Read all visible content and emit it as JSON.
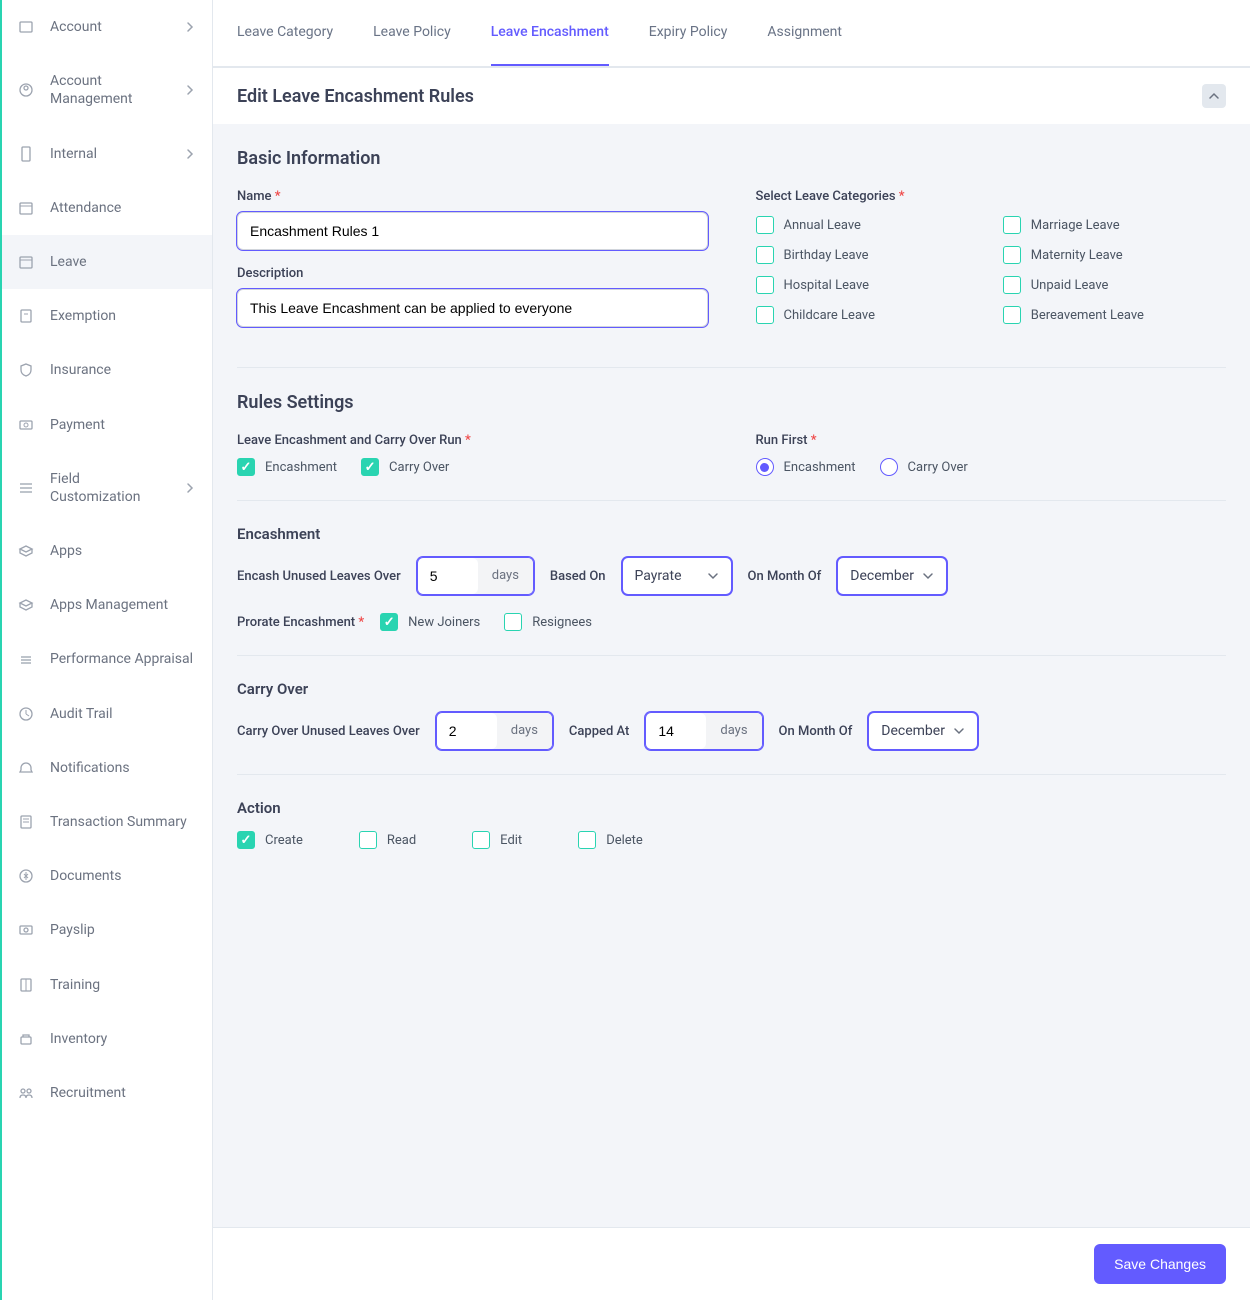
{
  "sidebar": {
    "items": [
      {
        "label": "Account",
        "chev": true
      },
      {
        "label": "Account Management",
        "chev": true
      },
      {
        "label": "Internal",
        "chev": true
      },
      {
        "label": "Attendance"
      },
      {
        "label": "Leave",
        "active": true
      },
      {
        "label": "Exemption"
      },
      {
        "label": "Insurance"
      },
      {
        "label": "Payment"
      },
      {
        "label": "Field Customization",
        "chev": true
      },
      {
        "label": "Apps"
      },
      {
        "label": "Apps Management"
      },
      {
        "label": "Performance Appraisal"
      },
      {
        "label": "Audit Trail"
      },
      {
        "label": "Notifications"
      },
      {
        "label": "Transaction Summary"
      },
      {
        "label": "Documents"
      },
      {
        "label": "Payslip"
      },
      {
        "label": "Training"
      },
      {
        "label": "Inventory"
      },
      {
        "label": "Recruitment"
      }
    ]
  },
  "tabs": [
    {
      "label": "Leave Category"
    },
    {
      "label": "Leave Policy"
    },
    {
      "label": "Leave Encashment",
      "active": true
    },
    {
      "label": "Expiry Policy"
    },
    {
      "label": "Assignment"
    }
  ],
  "page": {
    "title": "Edit Leave Encashment Rules"
  },
  "basic": {
    "heading": "Basic Information",
    "name_label": "Name",
    "name_value": "Encashment Rules 1",
    "desc_label": "Description",
    "desc_value": "This Leave Encashment can be applied to everyone",
    "cat_label": "Select Leave Categories",
    "categories": [
      {
        "label": "Annual Leave",
        "checked": false
      },
      {
        "label": "Marriage Leave",
        "checked": false
      },
      {
        "label": "Birthday Leave",
        "checked": false
      },
      {
        "label": "Maternity Leave",
        "checked": false
      },
      {
        "label": "Hospital Leave",
        "checked": false
      },
      {
        "label": "Unpaid Leave",
        "checked": false
      },
      {
        "label": "Childcare Leave",
        "checked": false
      },
      {
        "label": "Bereavement Leave",
        "checked": false
      }
    ]
  },
  "rules": {
    "heading": "Rules Settings",
    "period_label": "Leave Encashment and Carry Over Run",
    "opts": [
      {
        "label": "Encashment",
        "checked": true
      },
      {
        "label": "Carry Over",
        "checked": true
      }
    ],
    "first_label": "Run First",
    "first_opts": [
      {
        "label": "Encashment",
        "checked": true
      },
      {
        "label": "Carry Over",
        "checked": false
      }
    ]
  },
  "enc": {
    "title": "Encashment",
    "max_label": "Encash Unused Leaves Over",
    "max_value": "5",
    "unit": "days",
    "based_label": "Based On",
    "based_value": "Payrate",
    "month_label": "On Month Of",
    "month_value": "December",
    "prorate_label": "Prorate Encashment",
    "prorate_opts": [
      {
        "label": "New Joiners",
        "checked": true
      },
      {
        "label": "Resignees",
        "checked": false
      }
    ]
  },
  "carry": {
    "title": "Carry Over",
    "co_label": "Carry Over Unused Leaves Over",
    "co_value": "2",
    "co_unit": "days",
    "cap_label": "Capped At",
    "cap_value": "14",
    "cap_unit": "days",
    "month_label": "On Month Of",
    "month_value": "December"
  },
  "action": {
    "title": "Action",
    "opts": [
      {
        "label": "Create",
        "checked": true
      },
      {
        "label": "Read",
        "checked": false
      },
      {
        "label": "Edit",
        "checked": false
      },
      {
        "label": "Delete",
        "checked": false
      }
    ]
  },
  "footer": {
    "save": "Save Changes"
  }
}
